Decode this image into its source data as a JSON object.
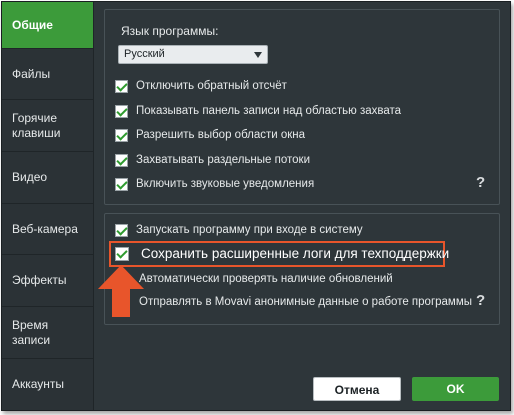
{
  "sidebar": {
    "items": [
      {
        "label": "Общие",
        "active": true
      },
      {
        "label": "Файлы",
        "active": false
      },
      {
        "label": "Горячие клавиши",
        "active": false
      },
      {
        "label": "Видео",
        "active": false
      },
      {
        "label": "Веб-камера",
        "active": false
      },
      {
        "label": "Эффекты",
        "active": false
      },
      {
        "label": "Время записи",
        "active": false
      },
      {
        "label": "Аккаунты",
        "active": false
      }
    ]
  },
  "general": {
    "language_label": "Язык программы:",
    "language_value": "Русский",
    "options": [
      {
        "label": "Отключить обратный отсчёт",
        "checked": true
      },
      {
        "label": "Показывать панель записи над областью захвата",
        "checked": true
      },
      {
        "label": "Разрешить выбор области окна",
        "checked": true
      },
      {
        "label": "Захватывать раздельные потоки",
        "checked": true
      },
      {
        "label": "Включить звуковые уведомления",
        "checked": true
      }
    ],
    "help_symbol": "?"
  },
  "system": {
    "options": [
      {
        "label": "Запускать программу при входе в систему",
        "checked": true
      },
      {
        "label": "Сохранить расширенные логи для техподдержки",
        "checked": true
      },
      {
        "label": "Автоматически проверять наличие обновлений",
        "checked": true
      },
      {
        "label": "Отправлять в Movavi анонимные данные о работе программы",
        "checked": true
      }
    ],
    "help_symbol": "?"
  },
  "buttons": {
    "cancel": "Отмена",
    "ok": "OK"
  },
  "colors": {
    "accent_green": "#3c9b3a",
    "highlight_orange": "#e8552b",
    "panel_dark": "#2e363a"
  }
}
